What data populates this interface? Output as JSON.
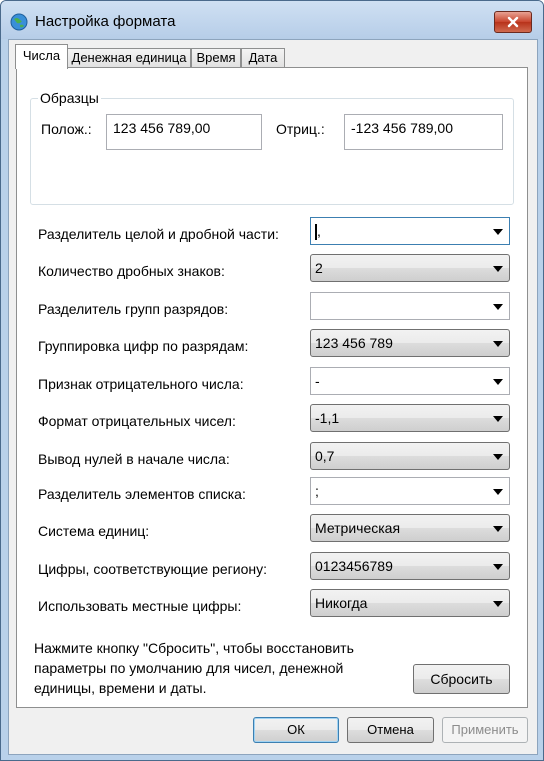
{
  "window": {
    "title": "Настройка формата",
    "close_icon": "close-icon",
    "app_icon": "globe-icon"
  },
  "tabs": [
    {
      "label": "Числа",
      "active": true
    },
    {
      "label": "Денежная единица",
      "active": false
    },
    {
      "label": "Время",
      "active": false
    },
    {
      "label": "Дата",
      "active": false
    }
  ],
  "samples": {
    "group_title": "Образцы",
    "positive_label": "Полож.:",
    "positive_value": "123 456 789,00",
    "negative_label": "Отриц.:",
    "negative_value": "-123 456 789,00"
  },
  "settings": [
    {
      "label": "Разделитель целой и дробной части:",
      "value": ",",
      "editable": true,
      "focused": true
    },
    {
      "label": "Количество дробных знаков:",
      "value": "2",
      "editable": false
    },
    {
      "label": "Разделитель групп разрядов:",
      "value": "",
      "editable": true
    },
    {
      "label": "Группировка цифр по разрядам:",
      "value": "123 456 789",
      "editable": false
    },
    {
      "label": "Признак отрицательного числа:",
      "value": "-",
      "editable": true
    },
    {
      "label": "Формат отрицательных чисел:",
      "value": "-1,1",
      "editable": false
    },
    {
      "label": "Вывод нулей в начале числа:",
      "value": "0,7",
      "editable": false
    },
    {
      "label": "Разделитель элементов списка:",
      "value": ";",
      "editable": true
    },
    {
      "label": "Система единиц:",
      "value": "Метрическая",
      "editable": false
    },
    {
      "label": "Цифры, соответствующие региону:",
      "value": "0123456789",
      "editable": false
    },
    {
      "label": "Использовать местные цифры:",
      "value": "Никогда",
      "editable": false
    }
  ],
  "reset_note": "Нажмите кнопку \"Сбросить\", чтобы восстановить параметры по умолчанию для чисел, денежной единицы, времени и даты.",
  "buttons": {
    "reset": "Сбросить",
    "ok": "ОК",
    "cancel": "Отмена",
    "apply": "Применить"
  }
}
